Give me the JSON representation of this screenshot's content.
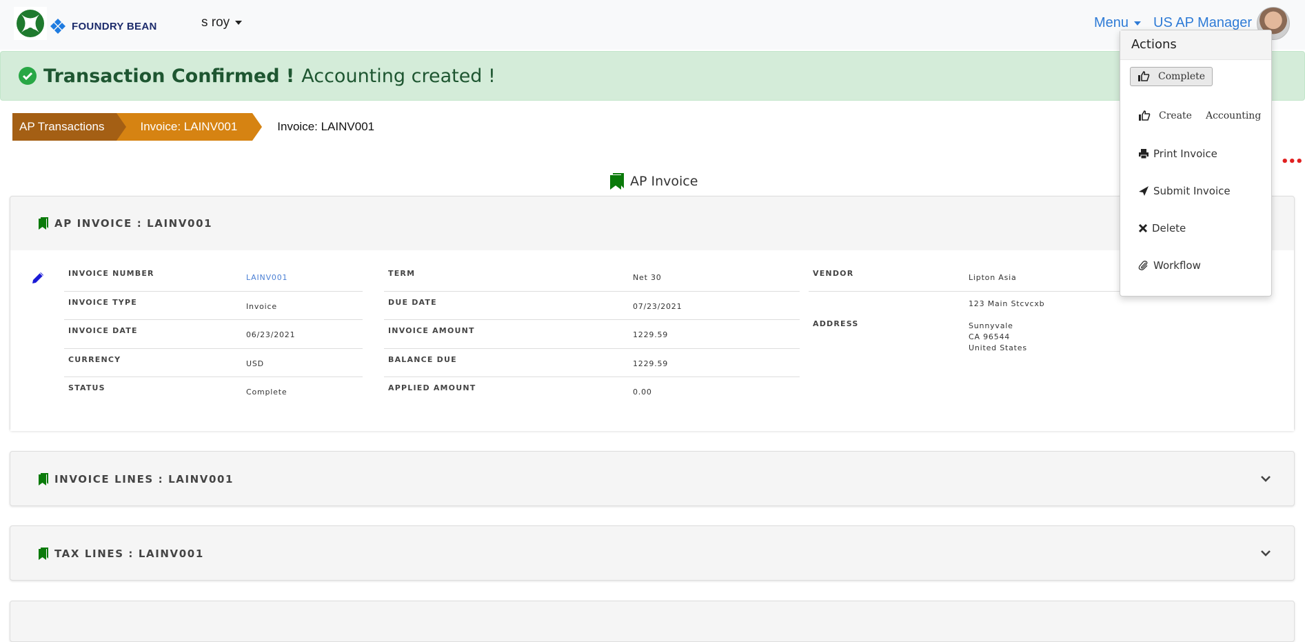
{
  "header": {
    "brand_name": "FOUNDRY BEAN",
    "user_menu_label": "s roy",
    "menu_label": "Menu",
    "role_label": "US AP Manager"
  },
  "banner": {
    "title": "Transaction Confirmed !",
    "message": "Accounting created !",
    "close_symbol": "✕",
    "background_color": "#d4ecd9",
    "text_color": "#1e5631"
  },
  "breadcrumb": {
    "items": [
      {
        "label": "AP Transactions"
      },
      {
        "label": "Invoice: LAINV001"
      },
      {
        "label": "Invoice: LAINV001"
      }
    ]
  },
  "page": {
    "title": "AP Invoice",
    "more_symbol": "•••"
  },
  "invoice_panel": {
    "title": "AP INVOICE : LAINV001",
    "col1": [
      {
        "label": "INVOICE NUMBER",
        "value": "LAINV001"
      },
      {
        "label": "INVOICE TYPE",
        "value": "Invoice"
      },
      {
        "label": "INVOICE DATE",
        "value": "06/23/2021"
      },
      {
        "label": "CURRENCY",
        "value": "USD"
      },
      {
        "label": "STATUS",
        "value": "Complete"
      }
    ],
    "col2": [
      {
        "label": "TERM",
        "value": "Net 30"
      },
      {
        "label": "DUE DATE",
        "value": "07/23/2021"
      },
      {
        "label": "INVOICE AMOUNT",
        "value": "1229.59"
      },
      {
        "label": "BALANCE DUE",
        "value": "1229.59"
      },
      {
        "label": "APPLIED AMOUNT",
        "value": "0.00"
      }
    ],
    "vendor": {
      "label": "VENDOR",
      "value": "Lipton Asia"
    },
    "address": {
      "label": "ADDRESS",
      "lines": [
        "123 Main Stcvcxb",
        "",
        "Sunnyvale",
        "CA 96544",
        "United States"
      ]
    }
  },
  "collapsed_panels": [
    {
      "title": "INVOICE LINES : LAINV001"
    },
    {
      "title": "TAX LINES : LAINV001"
    }
  ],
  "actions_menu": {
    "title": "Actions",
    "items": [
      {
        "label": "Complete",
        "icon": "thumbs-up-icon",
        "highlighted": true
      },
      {
        "label_part1": "Create",
        "label_part2": "Accounting",
        "icon": "thumbs-up-icon"
      },
      {
        "label": "Print Invoice",
        "icon": "print-icon"
      },
      {
        "label": "Submit Invoice",
        "icon": "send-icon"
      },
      {
        "label": "Delete",
        "icon": "close-icon"
      },
      {
        "label": "Workflow",
        "icon": "paperclip-icon"
      }
    ]
  },
  "colors": {
    "accent_link": "#2e7bd6",
    "breadcrumb_dark": "#a45f14",
    "breadcrumb_light": "#d68312",
    "bookmark_green": "#0a7a0a",
    "edit_blue": "#1a1ad6"
  }
}
